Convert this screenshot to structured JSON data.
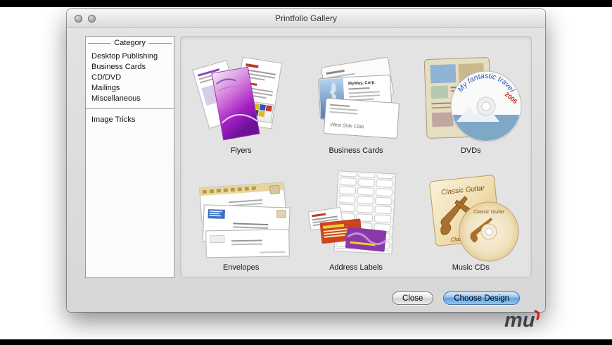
{
  "chrome": {
    "title": "Printfolio Gallery"
  },
  "sidebar": {
    "header": "Category",
    "items": [
      "Desktop Publishing",
      "Business Cards",
      "CD/DVD",
      "Mailings",
      "Miscellaneous"
    ],
    "extra_items": [
      "Image Tricks"
    ]
  },
  "gallery": {
    "items": [
      {
        "label": "Flyers"
      },
      {
        "label": "Business Cards",
        "card_company": "MyWay, Corp.",
        "card_footer": "West Side Club"
      },
      {
        "label": "DVDs",
        "disc_title": "My fantastic travel",
        "disc_year": "2006"
      },
      {
        "label": "Envelopes"
      },
      {
        "label": "Address Labels"
      },
      {
        "label": "Music CDs",
        "cover_title": "Classic Guitar"
      }
    ]
  },
  "footer": {
    "close_label": "Close",
    "choose_label": "Choose Design"
  },
  "watermark": {
    "text": "mu"
  },
  "colors": {
    "primary_button": "#61a4e0",
    "panel_bg": "#e3e3e3",
    "accent_red": "#c03028"
  }
}
